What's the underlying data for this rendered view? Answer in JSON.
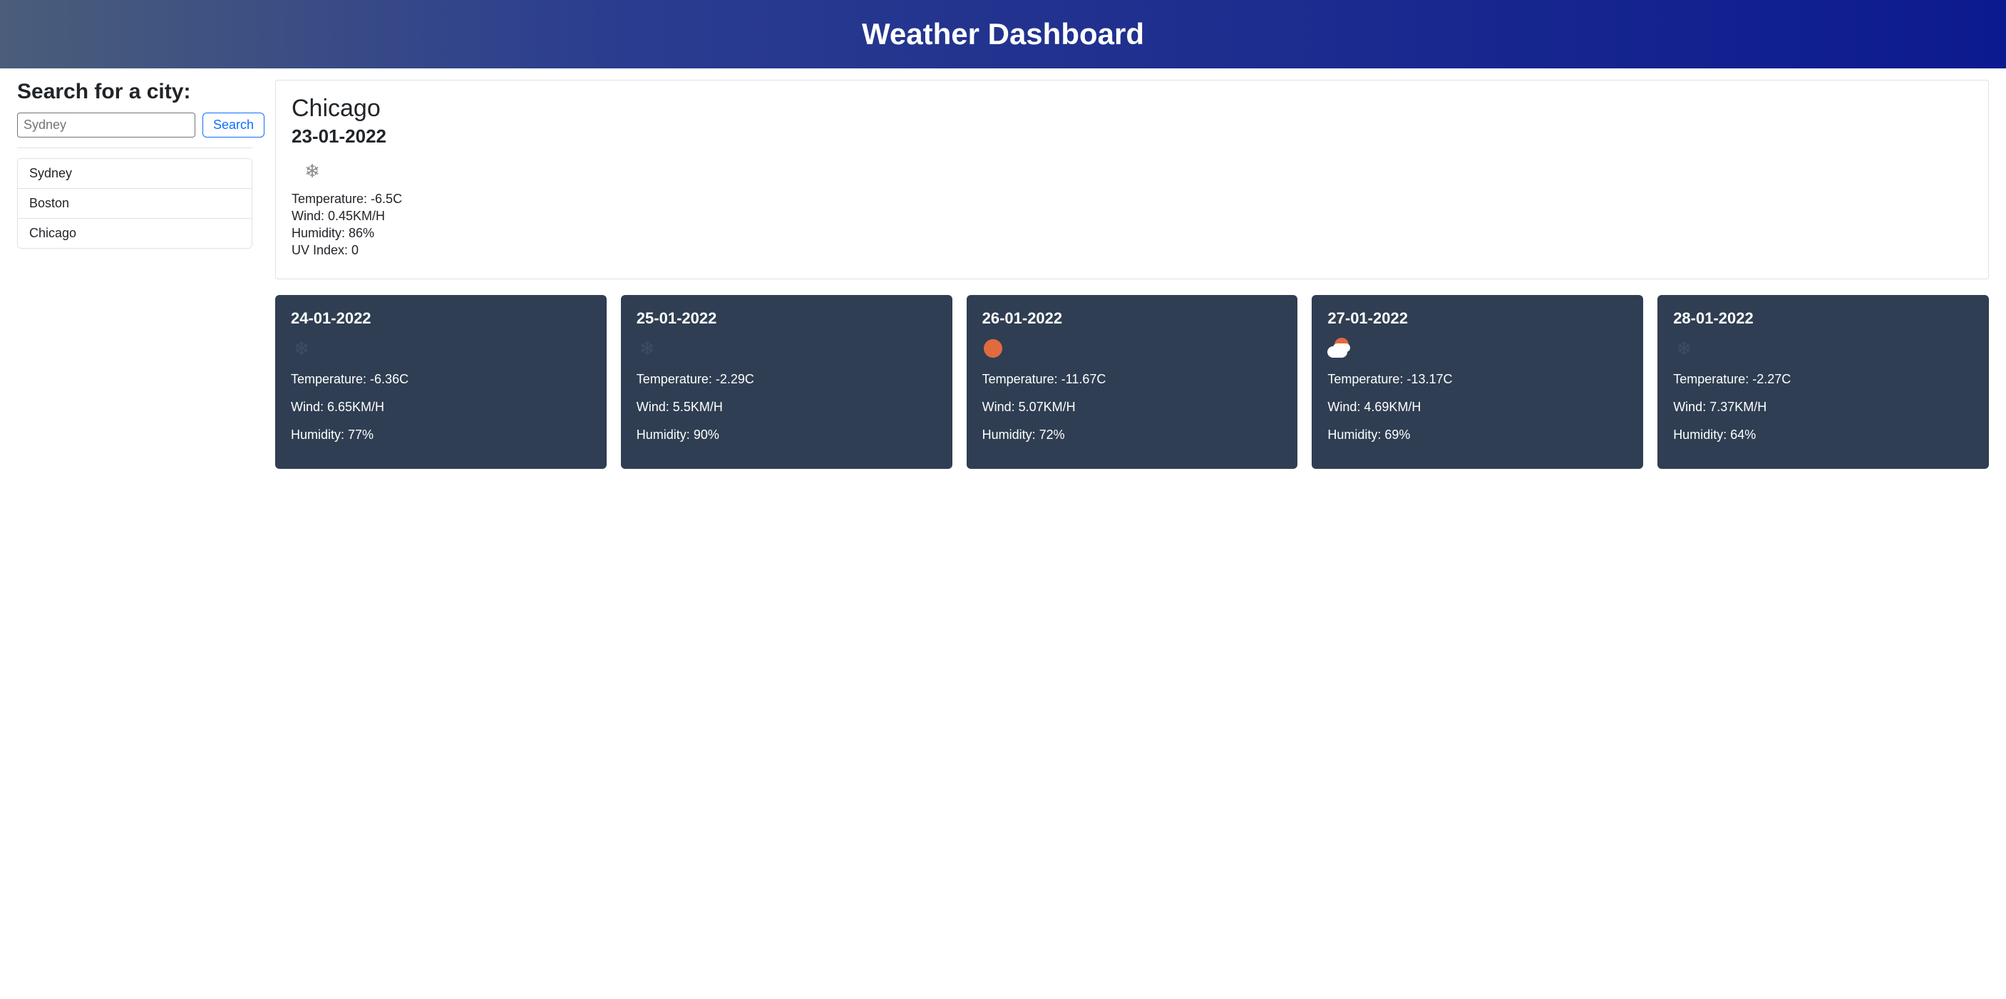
{
  "header": {
    "title": "Weather Dashboard"
  },
  "sidebar": {
    "search_label": "Search for a city:",
    "search_placeholder": "Sydney",
    "search_button": "Search",
    "history": [
      "Sydney",
      "Boston",
      "Chicago"
    ]
  },
  "current": {
    "city": "Chicago",
    "date": "23-01-2022",
    "icon": "snowflake",
    "temperature": "Temperature: -6.5C",
    "wind": "Wind: 0.45KM/H",
    "humidity": "Humidity: 86%",
    "uv": "UV Index: 0"
  },
  "forecast": [
    {
      "date": "24-01-2022",
      "icon": "snowflake",
      "temperature": "Temperature: -6.36C",
      "wind": "Wind: 6.65KM/H",
      "humidity": "Humidity: 77%"
    },
    {
      "date": "25-01-2022",
      "icon": "snowflake",
      "temperature": "Temperature: -2.29C",
      "wind": "Wind: 5.5KM/H",
      "humidity": "Humidity: 90%"
    },
    {
      "date": "26-01-2022",
      "icon": "sunny",
      "temperature": "Temperature: -11.67C",
      "wind": "Wind: 5.07KM/H",
      "humidity": "Humidity: 72%"
    },
    {
      "date": "27-01-2022",
      "icon": "partly-cloudy",
      "temperature": "Temperature: -13.17C",
      "wind": "Wind: 4.69KM/H",
      "humidity": "Humidity: 69%"
    },
    {
      "date": "28-01-2022",
      "icon": "snowflake",
      "temperature": "Temperature: -2.27C",
      "wind": "Wind: 7.37KM/H",
      "humidity": "Humidity: 64%"
    }
  ]
}
